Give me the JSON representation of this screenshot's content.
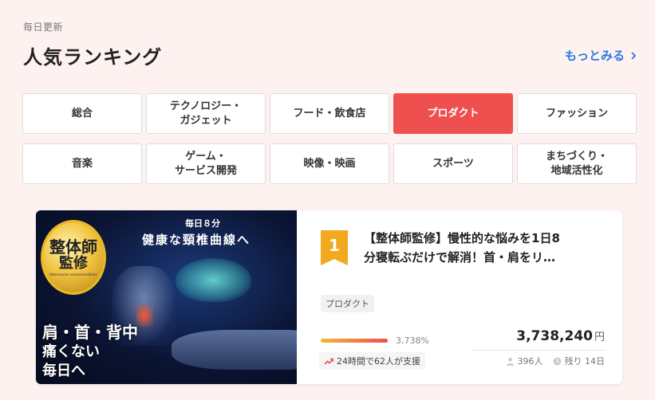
{
  "header": {
    "update_label": "毎日更新",
    "title": "人気ランキング",
    "more_link": "もっとみる"
  },
  "categories": [
    {
      "label": "総合",
      "active": false
    },
    {
      "label": "テクノロジー・\nガジェット",
      "active": false
    },
    {
      "label": "フード・飲食店",
      "active": false
    },
    {
      "label": "プロダクト",
      "active": true
    },
    {
      "label": "ファッション",
      "active": false
    },
    {
      "label": "音楽",
      "active": false
    },
    {
      "label": "ゲーム・\nサービス開発",
      "active": false
    },
    {
      "label": "映像・映画",
      "active": false
    },
    {
      "label": "スポーツ",
      "active": false
    },
    {
      "label": "まちづくり・\n地域活性化",
      "active": false
    }
  ],
  "ranking_item": {
    "rank": "1",
    "title_line1": "【整体師監修】慢性的な悩みを1日8",
    "title_line2": "分寝転ぶだけで解消！首・肩をリ…",
    "category_tag": "プロダクト",
    "progress_percent_label": "3,738%",
    "progress_fraction": 1.0,
    "amount": "3,738,240",
    "amount_unit": "円",
    "trend_text": "24時間で62人が支援",
    "supporters": "396人",
    "remaining": "残り 14日",
    "image": {
      "badge_main": "整体師",
      "badge_sub": "監修",
      "badge_en": "Veterinarian recommendation",
      "daily": "毎日８分",
      "headline": "健康な頸椎曲線へ",
      "copy_line1": "肩・首・背中",
      "copy_line2": "痛くない",
      "copy_line3": "毎日へ"
    }
  },
  "colors": {
    "accent_red": "#ef4f4f",
    "link_blue": "#2a7ae2",
    "rank_gold": "#f2a91f",
    "background": "#fdf2f0"
  }
}
